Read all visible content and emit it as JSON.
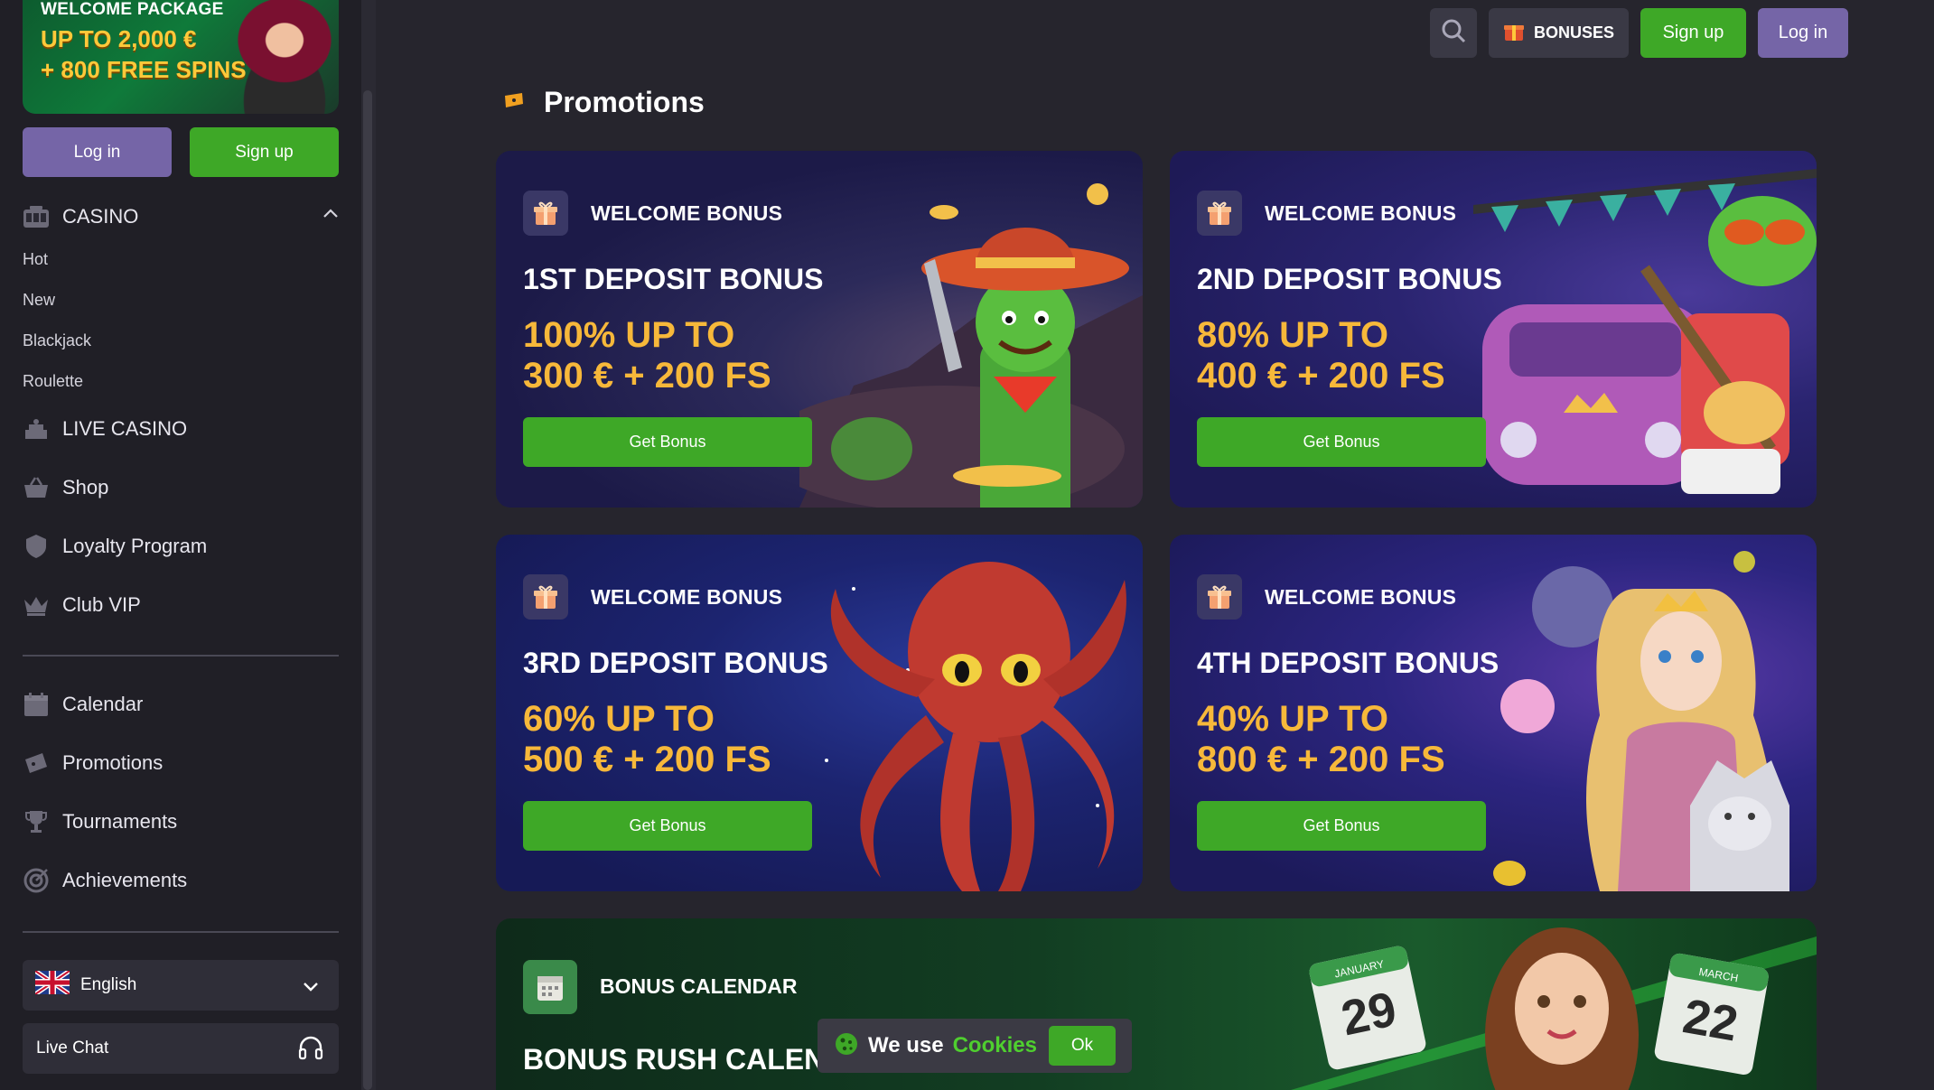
{
  "sidebar": {
    "promo": {
      "line1": "WELCOME PACKAGE",
      "line2": "UP TO 2,000 €",
      "line3": "+ 800 FREE SPINS"
    },
    "login_label": "Log in",
    "signup_label": "Sign up",
    "casino": {
      "label": "CASINO",
      "sub": [
        "Hot",
        "New",
        "Blackjack",
        "Roulette"
      ]
    },
    "nav_main": [
      {
        "label": "LIVE CASINO",
        "icon": "live-casino-icon"
      },
      {
        "label": "Shop",
        "icon": "shop-basket-icon"
      },
      {
        "label": "Loyalty Program",
        "icon": "loyalty-shield-icon"
      },
      {
        "label": "Club VIP",
        "icon": "crown-icon"
      }
    ],
    "nav_secondary": [
      {
        "label": "Calendar",
        "icon": "calendar-icon"
      },
      {
        "label": "Promotions",
        "icon": "ticket-icon"
      },
      {
        "label": "Tournaments",
        "icon": "trophy-icon"
      },
      {
        "label": "Achievements",
        "icon": "target-icon"
      }
    ],
    "language": "English",
    "live_chat": "Live Chat"
  },
  "topbar": {
    "bonuses_label": "BONUSES",
    "signup_label": "Sign up",
    "login_label": "Log in"
  },
  "page": {
    "title": "Promotions"
  },
  "cards": [
    {
      "tag": "WELCOME BONUS",
      "title": "1ST DEPOSIT BONUS",
      "amount1": "100% UP TO",
      "amount2": "300 € + 200 FS",
      "button": "Get Bonus"
    },
    {
      "tag": "WELCOME BONUS",
      "title": "2ND DEPOSIT BONUS",
      "amount1": "80% UP TO",
      "amount2": "400 € + 200 FS",
      "button": "Get Bonus"
    },
    {
      "tag": "WELCOME BONUS",
      "title": "3RD DEPOSIT BONUS",
      "amount1": "60% UP TO",
      "amount2": "500 € + 200 FS",
      "button": "Get Bonus"
    },
    {
      "tag": "WELCOME BONUS",
      "title": "4TH DEPOSIT BONUS",
      "amount1": "40% UP TO",
      "amount2": "800 € + 200 FS",
      "button": "Get Bonus"
    }
  ],
  "calendar_card": {
    "tag": "BONUS CALENDAR",
    "title": "BONUS RUSH CALENDAR",
    "date1_month": "JANUARY",
    "date1_day": "29",
    "date2_month": "MARCH",
    "date2_day": "22"
  },
  "cookie": {
    "text": "We use",
    "link": "Cookies",
    "ok": "Ok"
  },
  "colors": {
    "accent_green": "#3ea827",
    "accent_purple": "#7565a7",
    "gold": "#f7b83a",
    "background": "#26252d",
    "sidebar": "#201f26"
  }
}
